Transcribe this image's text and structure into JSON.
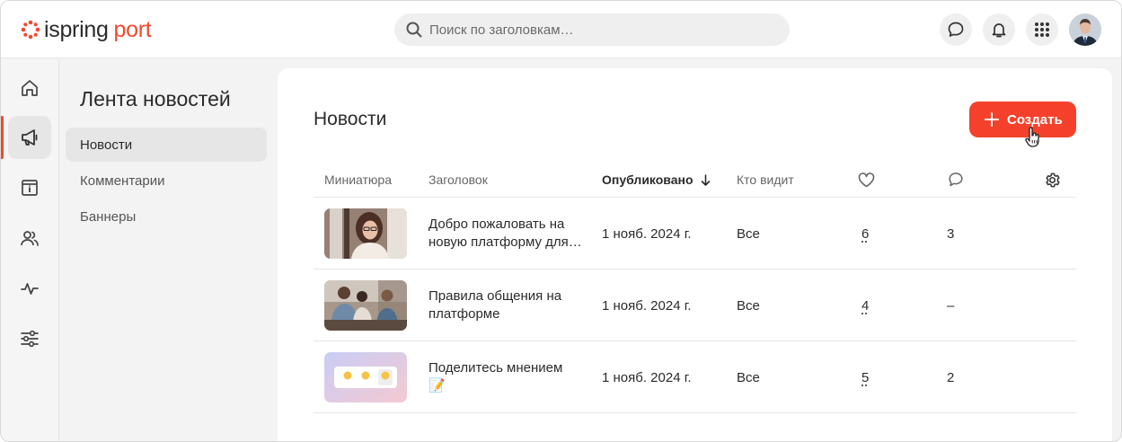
{
  "header": {
    "logo_word1": "ispring",
    "logo_word2": "port",
    "search_placeholder": "Поиск по заголовкам…"
  },
  "subnav": {
    "title": "Лента новостей",
    "items": [
      {
        "label": "Новости",
        "active": true
      },
      {
        "label": "Комментарии",
        "active": false
      },
      {
        "label": "Баннеры",
        "active": false
      }
    ]
  },
  "main": {
    "title": "Новости",
    "create_label": "Создать",
    "columns": {
      "thumbnail": "Миниатюра",
      "title": "Заголовок",
      "published": "Опубликовано",
      "audience": "Кто видит"
    },
    "rows": [
      {
        "title_line1": "Добро пожаловать на",
        "title_line2": "новую платформу для…",
        "date": "1 нояб. 2024 г.",
        "audience": "Все",
        "likes": "6",
        "comments": "3"
      },
      {
        "title_line1": "Правила общения на",
        "title_line2": "платформе",
        "date": "1 нояб. 2024 г.",
        "audience": "Все",
        "likes": "4",
        "comments": "–"
      },
      {
        "title_line1": "Поделитесь мнением",
        "title_line2": "📝",
        "date": "1 нояб. 2024 г.",
        "audience": "Все",
        "likes": "5",
        "comments": "2"
      }
    ]
  },
  "colors": {
    "accent": "#f5412b",
    "brand": "#f04a2f"
  }
}
